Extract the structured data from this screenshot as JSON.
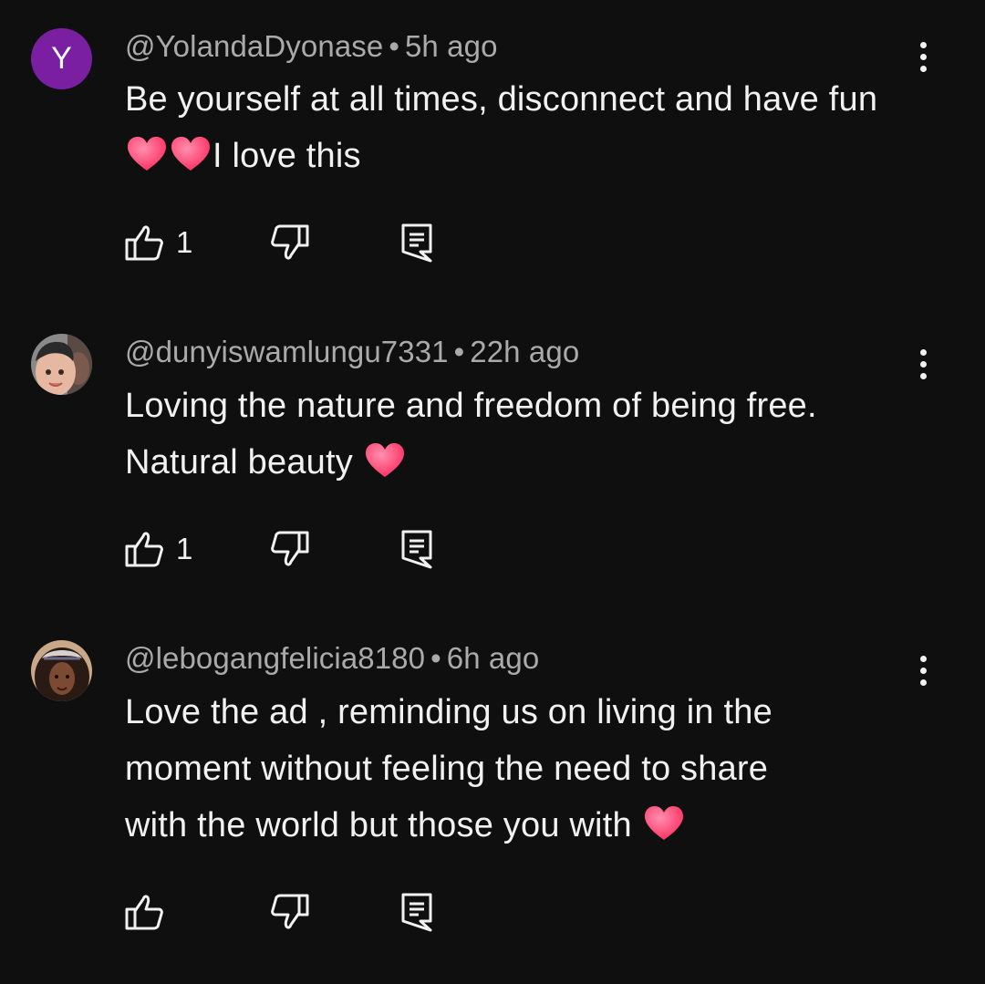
{
  "comments": [
    {
      "avatar_letter": "Y",
      "handle": "@YolandaDyonase",
      "separator": "•",
      "time": "5h ago",
      "text_part1": "Be yourself at all times, disconnect and have fun",
      "text_part2": "I love this",
      "likes": "1",
      "icons": [
        "heart-emoji",
        "thumbs-up-icon",
        "thumbs-down-icon",
        "reply-icon",
        "more-vert-icon"
      ]
    },
    {
      "handle": "@dunyiswamlungu7331",
      "separator": "•",
      "time": "22h ago",
      "text_line1": "Loving the nature and freedom of being free.",
      "text_line2": "Natural beauty ",
      "likes": "1",
      "icons": [
        "avatar-photo",
        "heart-emoji",
        "thumbs-up-icon",
        "thumbs-down-icon",
        "reply-icon",
        "more-vert-icon"
      ]
    },
    {
      "handle": "@lebogangfelicia8180",
      "separator": "•",
      "time": "6h ago",
      "text_line1": "Love the ad , reminding us on living in the",
      "text_line2": "moment without feeling the need to share",
      "text_line3": "with the world but those you with ",
      "likes": "",
      "icons": [
        "avatar-photo",
        "heart-emoji",
        "thumbs-up-icon",
        "thumbs-down-icon",
        "reply-icon",
        "more-vert-icon"
      ]
    }
  ],
  "colors": {
    "background": "#0f0f0f",
    "text": "#f1f1f1",
    "meta": "#aaaaaa",
    "avatar_y": "#7b1fa2",
    "heart": "#ff3d6e"
  }
}
